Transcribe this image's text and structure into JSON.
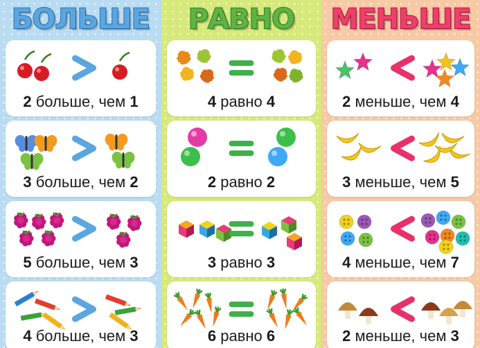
{
  "columns": [
    {
      "heading": "БОЛЬШЕ",
      "color": "#5ba6de",
      "sign_color": "#5ba6de",
      "rows": [
        {
          "icon": "cherry-icon",
          "left": "2",
          "word": "больше, чем",
          "right": "1"
        },
        {
          "icon": "butterfly-icon",
          "left": "3",
          "word": "больше, чем",
          "right": "2"
        },
        {
          "icon": "raspberry-icon",
          "left": "5",
          "word": "больше, чем",
          "right": "3"
        },
        {
          "icon": "pencil-icon",
          "left": "4",
          "word": "больше, чем",
          "right": "3"
        }
      ]
    },
    {
      "heading": "РАВНО",
      "color": "#5fb342",
      "sign_color": "#3fb14a",
      "rows": [
        {
          "icon": "oak-leaf-icon",
          "left": "4",
          "word": "равно",
          "right": "4"
        },
        {
          "icon": "ball-icon",
          "left": "2",
          "word": "равно",
          "right": "2"
        },
        {
          "icon": "cube-icon",
          "left": "3",
          "word": "равно",
          "right": "3"
        },
        {
          "icon": "carrot-icon",
          "left": "6",
          "word": "равно",
          "right": "6"
        }
      ]
    },
    {
      "heading": "МЕНЬШЕ",
      "color": "#ee3f6b",
      "sign_color": "#e8316a",
      "rows": [
        {
          "icon": "star-icon",
          "left": "2",
          "word": "меньше, чем",
          "right": "4"
        },
        {
          "icon": "banana-icon",
          "left": "3",
          "word": "меньше, чем",
          "right": "5"
        },
        {
          "icon": "button-icon",
          "left": "4",
          "word": "меньше, чем",
          "right": "7"
        },
        {
          "icon": "mushroom-icon",
          "left": "2",
          "word": "меньше, чем",
          "right": "3"
        }
      ]
    }
  ]
}
